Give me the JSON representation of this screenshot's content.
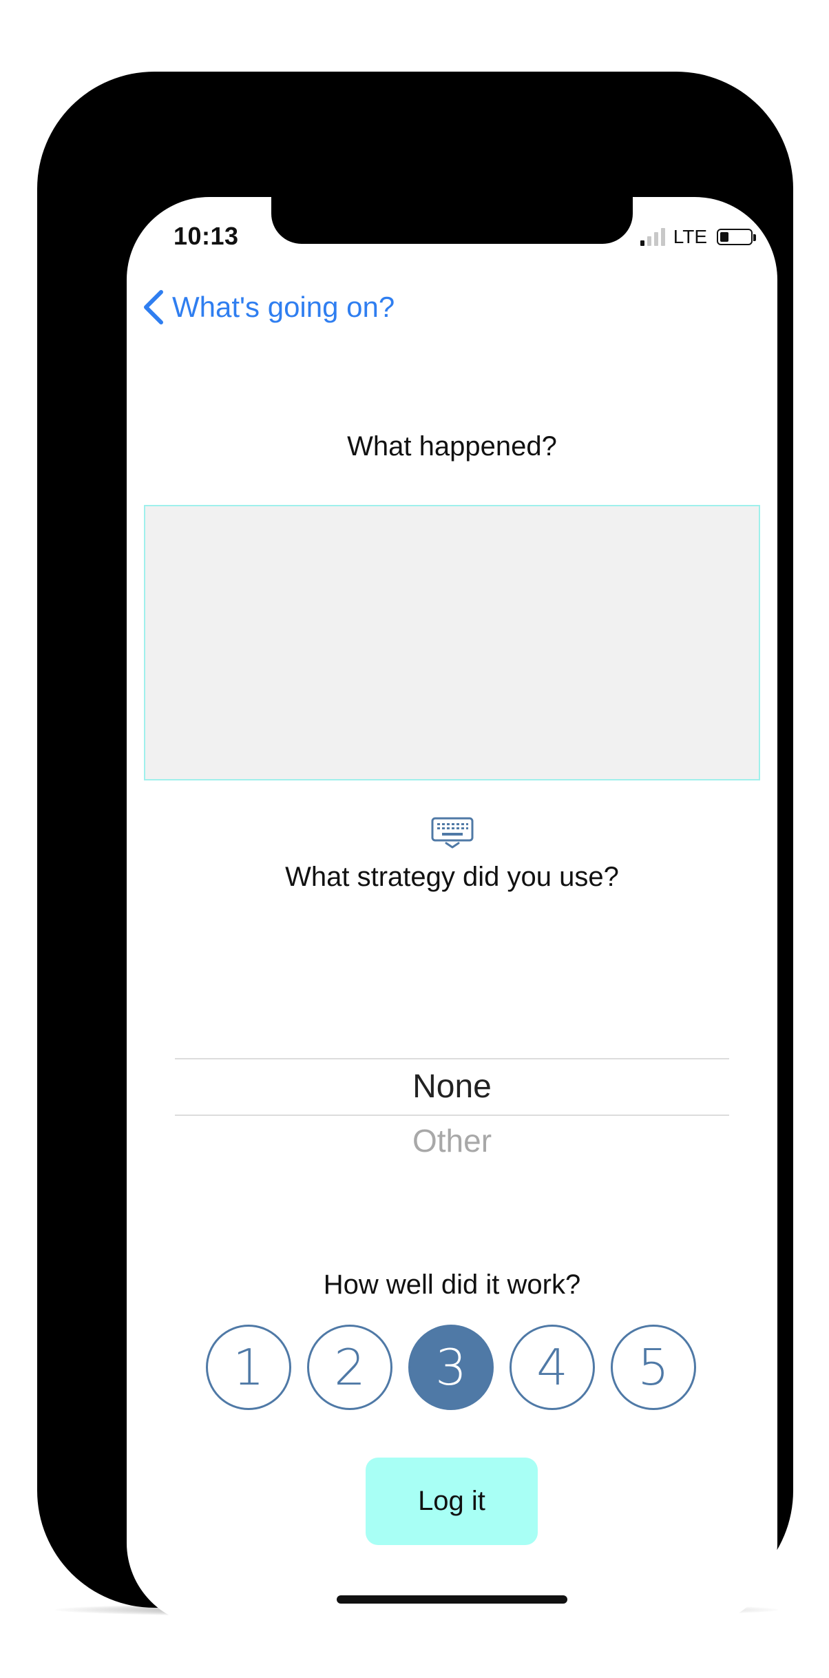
{
  "status_bar": {
    "time": "10:13",
    "network": "LTE",
    "signal_bars_active": 1,
    "signal_bars_total": 4,
    "battery_level": 0.2
  },
  "nav": {
    "back_label": "What's going on?",
    "back_icon": "chevron-left-icon"
  },
  "form": {
    "what_happened_label": "What happened?",
    "what_happened_value": "",
    "keyboard_icon": "keyboard-icon",
    "strategy_label": "What strategy did you use?",
    "strategy_picker": {
      "selected": "None",
      "next": "Other"
    },
    "rating_label": "How well did it work?",
    "ratings": [
      "1",
      "2",
      "3",
      "4",
      "5"
    ],
    "selected_rating": "3",
    "submit_label": "Log it"
  },
  "colors": {
    "accent_blue": "#2f7ef0",
    "rating_blue": "#4f79a6",
    "button_teal": "#a8fff5",
    "textarea_border": "#9ff0ec",
    "textarea_fill": "#f1f1f1"
  }
}
